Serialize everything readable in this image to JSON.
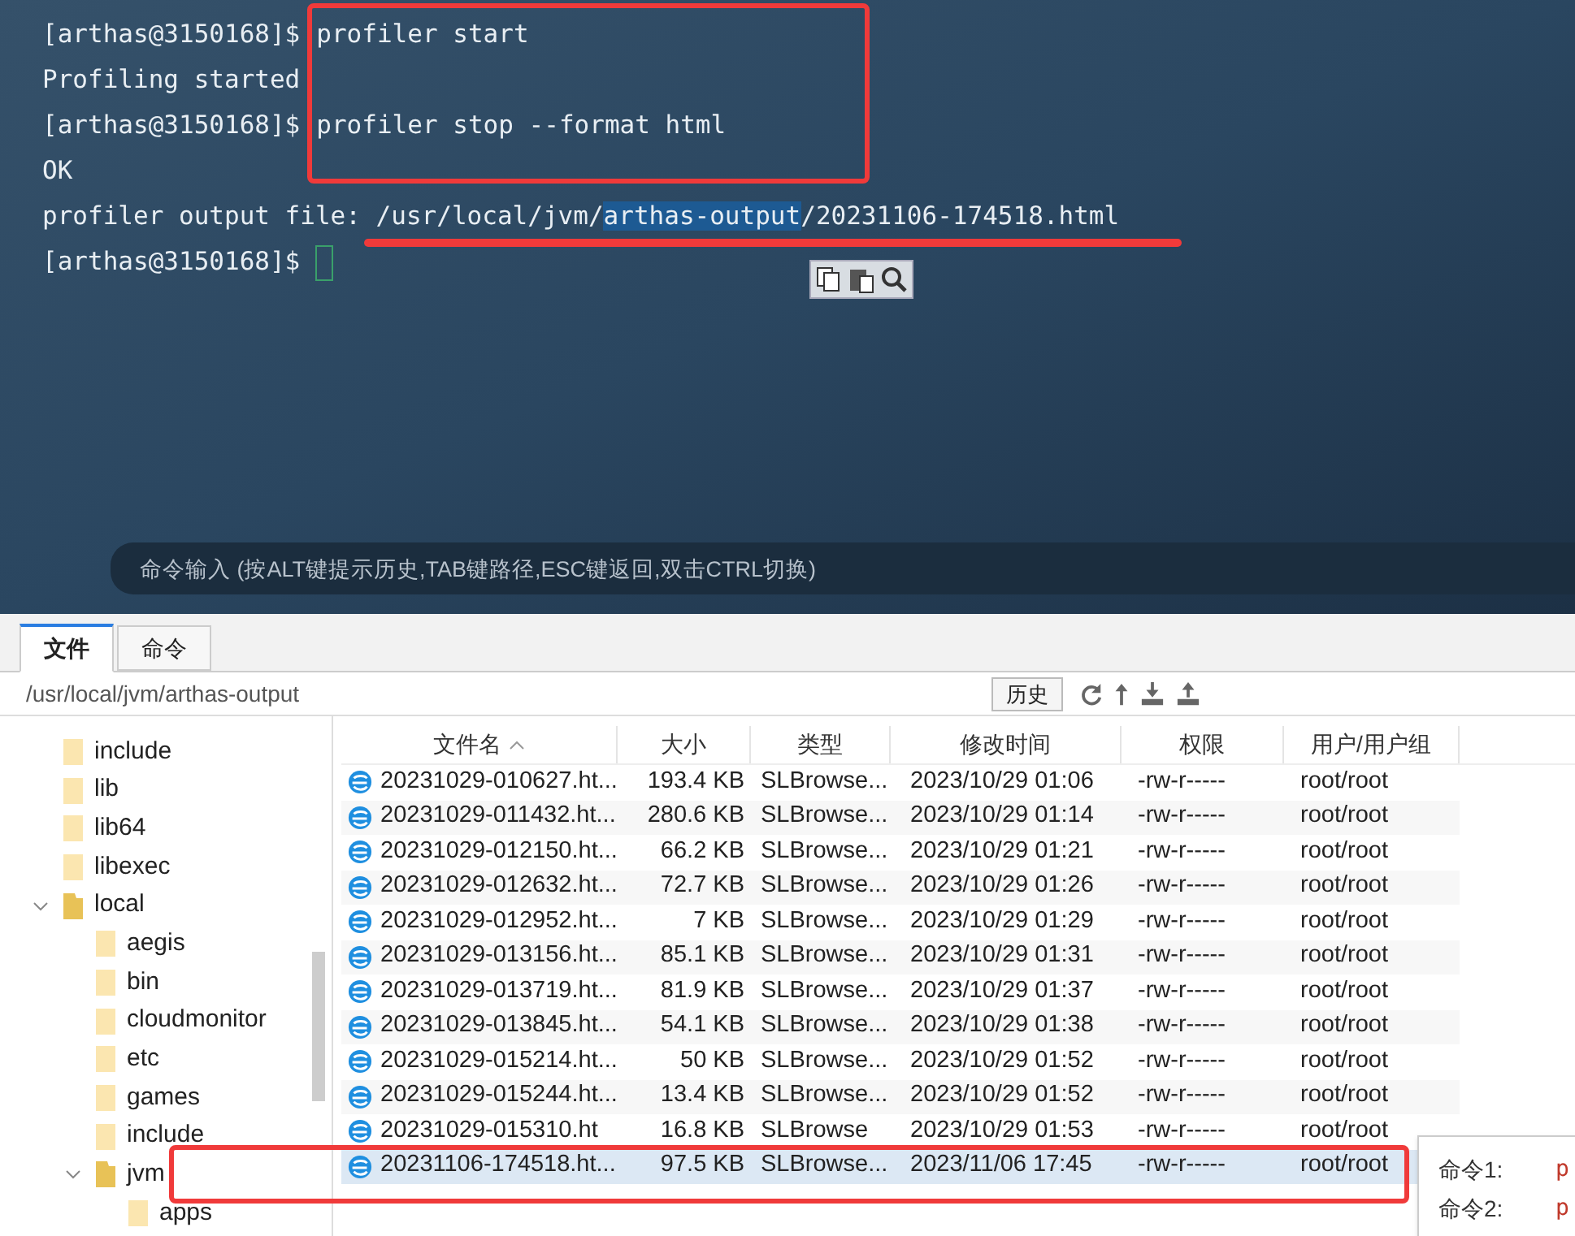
{
  "terminal": {
    "lines": [
      {
        "kind": "command",
        "prompt": "[arthas@3150168]$",
        "command": "profiler start"
      },
      {
        "kind": "output",
        "segments": [
          {
            "text": "Profiling started",
            "selected": false
          }
        ]
      },
      {
        "kind": "command",
        "prompt": "[arthas@3150168]$",
        "command": "profiler stop --format html"
      },
      {
        "kind": "output",
        "segments": [
          {
            "text": "OK",
            "selected": false
          }
        ]
      },
      {
        "kind": "output",
        "segments": [
          {
            "text": "profiler output file: /usr/local/jvm/",
            "selected": false
          },
          {
            "text": "arthas-output",
            "selected": true
          },
          {
            "text": "/20231106-174518.html",
            "selected": false
          }
        ]
      },
      {
        "kind": "prompt",
        "prompt": "[arthas@3150168]$"
      }
    ],
    "command_input": {
      "placeholder": "命令输入 (按ALT键提示历史,TAB键路径,ESC键返回,双击CTRL切换)"
    }
  },
  "tabs": [
    {
      "label": "文件",
      "selected": true
    },
    {
      "label": "命令",
      "selected": false
    }
  ],
  "path_bar": {
    "path": "/usr/local/jvm/arthas-output",
    "history_button": "历史"
  },
  "tree": [
    {
      "label": "include"
    },
    {
      "label": "lib"
    },
    {
      "label": "lib64"
    },
    {
      "label": "libexec"
    },
    {
      "label": "local",
      "expanded": true,
      "children": [
        {
          "label": "aegis"
        },
        {
          "label": "bin"
        },
        {
          "label": "cloudmonitor"
        },
        {
          "label": "etc"
        },
        {
          "label": "games"
        },
        {
          "label": "include"
        },
        {
          "label": "jvm",
          "expanded": true,
          "children": [
            {
              "label": "apps"
            }
          ]
        }
      ]
    }
  ],
  "table": {
    "columns": [
      {
        "label": "文件名",
        "sorted": true
      },
      {
        "label": "大小",
        "sorted": false
      },
      {
        "label": "类型",
        "sorted": false
      },
      {
        "label": "修改时间",
        "sorted": false
      },
      {
        "label": "权限",
        "sorted": false
      },
      {
        "label": "用户/用户组",
        "sorted": false
      }
    ],
    "rows": [
      {
        "name": "20231029-010627.ht...",
        "size": "193.4 KB",
        "type": "SLBrowse...",
        "modified": "2023/10/29 01:06",
        "permissions": "-rw-r-----",
        "owner": "root/root",
        "selected": false
      },
      {
        "name": "20231029-011432.ht...",
        "size": "280.6 KB",
        "type": "SLBrowse...",
        "modified": "2023/10/29 01:14",
        "permissions": "-rw-r-----",
        "owner": "root/root",
        "selected": false
      },
      {
        "name": "20231029-012150.ht...",
        "size": "66.2 KB",
        "type": "SLBrowse...",
        "modified": "2023/10/29 01:21",
        "permissions": "-rw-r-----",
        "owner": "root/root",
        "selected": false
      },
      {
        "name": "20231029-012632.ht...",
        "size": "72.7 KB",
        "type": "SLBrowse...",
        "modified": "2023/10/29 01:26",
        "permissions": "-rw-r-----",
        "owner": "root/root",
        "selected": false
      },
      {
        "name": "20231029-012952.ht...",
        "size": "7 KB",
        "type": "SLBrowse...",
        "modified": "2023/10/29 01:29",
        "permissions": "-rw-r-----",
        "owner": "root/root",
        "selected": false
      },
      {
        "name": "20231029-013156.ht...",
        "size": "85.1 KB",
        "type": "SLBrowse...",
        "modified": "2023/10/29 01:31",
        "permissions": "-rw-r-----",
        "owner": "root/root",
        "selected": false
      },
      {
        "name": "20231029-013719.ht...",
        "size": "81.9 KB",
        "type": "SLBrowse...",
        "modified": "2023/10/29 01:37",
        "permissions": "-rw-r-----",
        "owner": "root/root",
        "selected": false
      },
      {
        "name": "20231029-013845.ht...",
        "size": "54.1 KB",
        "type": "SLBrowse...",
        "modified": "2023/10/29 01:38",
        "permissions": "-rw-r-----",
        "owner": "root/root",
        "selected": false
      },
      {
        "name": "20231029-015214.ht...",
        "size": "50 KB",
        "type": "SLBrowse...",
        "modified": "2023/10/29 01:52",
        "permissions": "-rw-r-----",
        "owner": "root/root",
        "selected": false
      },
      {
        "name": "20231029-015244.ht...",
        "size": "13.4 KB",
        "type": "SLBrowse...",
        "modified": "2023/10/29 01:52",
        "permissions": "-rw-r-----",
        "owner": "root/root",
        "selected": false
      },
      {
        "name": "20231029-015310.ht",
        "size": "16.8 KB",
        "type": "SLBrowse",
        "modified": "2023/10/29 01:53",
        "permissions": "-rw-r-----",
        "owner": "root/root",
        "selected": false
      },
      {
        "name": "20231106-174518.ht...",
        "size": "97.5 KB",
        "type": "SLBrowse...",
        "modified": "2023/11/06 17:45",
        "permissions": "-rw-r-----",
        "owner": "root/root",
        "selected": true
      }
    ]
  },
  "popup": {
    "items": [
      {
        "label": "命令1:",
        "value": "p"
      },
      {
        "label": "命令2:",
        "value": "p"
      }
    ]
  }
}
